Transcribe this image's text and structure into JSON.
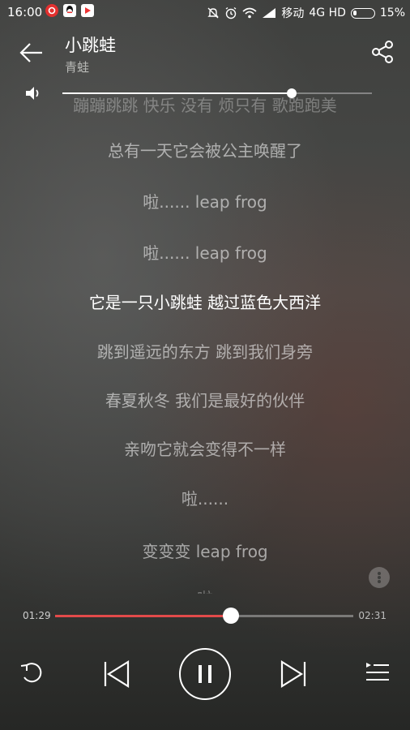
{
  "status": {
    "time": "16:00",
    "carrier": "移动",
    "network": "4G HD",
    "battery": "15%",
    "battery_level": 0.15,
    "left_icons": [
      "netease-news-icon",
      "qq-icon",
      "play-store-icon"
    ],
    "right_icons": [
      "mute-icon",
      "alarm-icon",
      "wifi-icon",
      "signal-icon",
      "battery-icon"
    ]
  },
  "header": {
    "title": "小跳蛙",
    "artist": "青蛙"
  },
  "volume": {
    "level": 0.74
  },
  "lyrics": [
    {
      "text": "蹦蹦跳跳 快乐 没有 烦只有 歌跑跑美",
      "state": "clipped"
    },
    {
      "text": "总有一天它会被公主唤醒了",
      "state": "normal"
    },
    {
      "text": "啦...... leap frog",
      "state": "normal"
    },
    {
      "text": "啦...... leap frog",
      "state": "normal"
    },
    {
      "text": "它是一只小跳蛙 越过蓝色大西洋",
      "state": "active"
    },
    {
      "text": "跳到遥远的东方 跳到我们身旁",
      "state": "normal"
    },
    {
      "text": "春夏秋冬 我们是最好的伙伴",
      "state": "normal"
    },
    {
      "text": "亲吻它就会变得不一样",
      "state": "normal"
    },
    {
      "text": "啦......",
      "state": "normal"
    },
    {
      "text": "变变变 leap frog",
      "state": "normal"
    },
    {
      "text": "啦",
      "state": "clipped-bottom"
    }
  ],
  "playback": {
    "current_time": "01:29",
    "total_time": "02:31",
    "progress": 0.589
  },
  "colors": {
    "progress_fill": "#e24a4a"
  }
}
